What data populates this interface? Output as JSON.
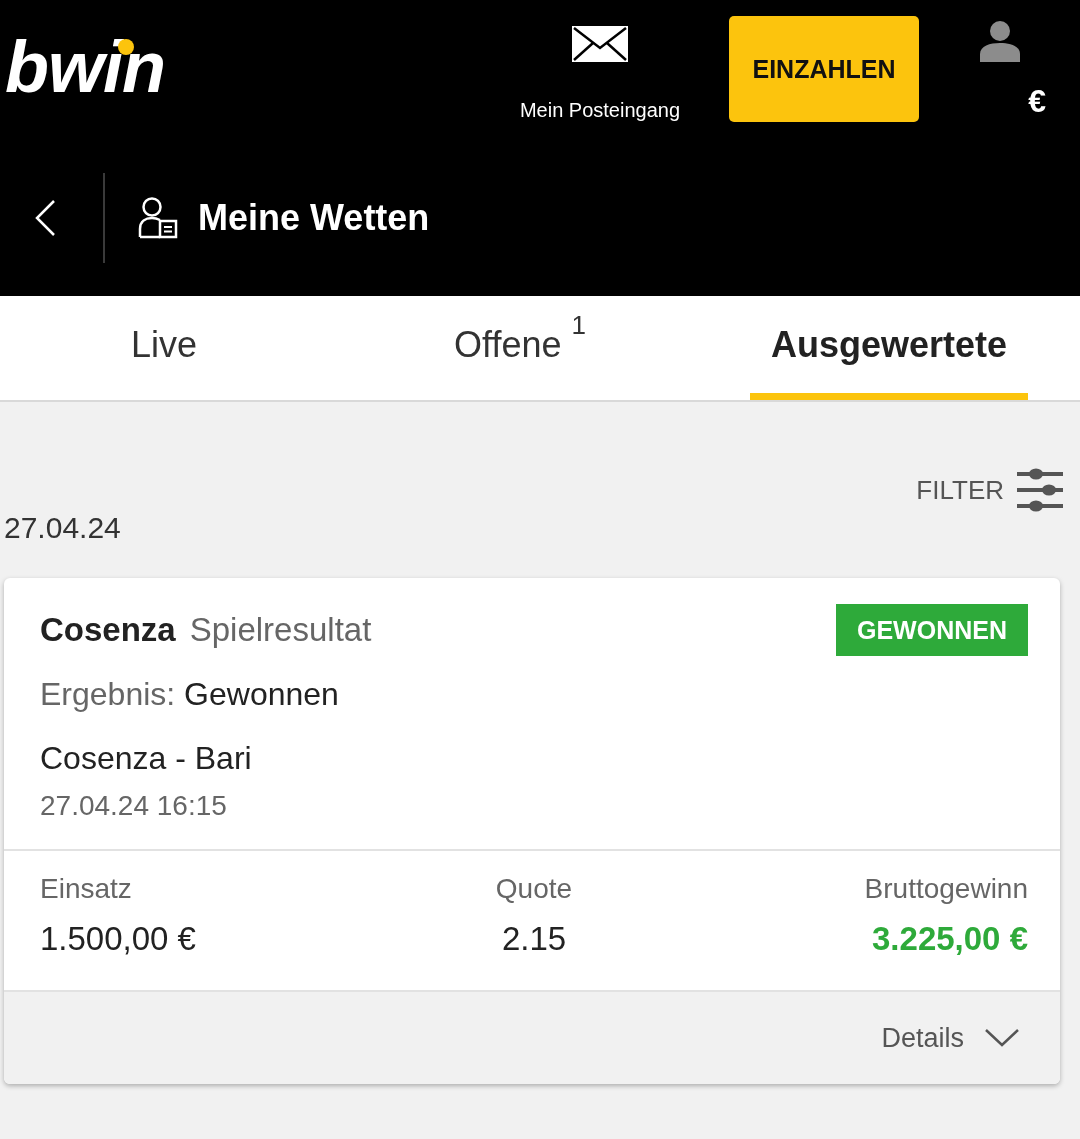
{
  "header": {
    "logo": "bwin",
    "inbox_label": "Mein Posteingang",
    "deposit_button": "EINZAHLEN",
    "balance": "€"
  },
  "page_bar": {
    "title": "Meine Wetten"
  },
  "tabs": [
    {
      "label": "Live",
      "selected": false
    },
    {
      "label": "Offene",
      "count": "1",
      "selected": false
    },
    {
      "label": "Ausgewertete",
      "selected": true
    }
  ],
  "filter": {
    "label": "FILTER"
  },
  "bets": [
    {
      "date": "27.04.24",
      "selection": "Cosenza",
      "market": "Spielresultat",
      "status": {
        "label": "GEWONNEN",
        "kind": "won"
      },
      "result_label": "Ergebnis:",
      "result": "Gewonnen",
      "event": "Cosenza - Bari",
      "start_time": "27.04.24 16:15",
      "stats": [
        {
          "label": "Einsatz",
          "value": "1.500,00 €",
          "kind": "plain"
        },
        {
          "label": "Quote",
          "value": "2.15",
          "kind": "plain"
        },
        {
          "label": "Bruttogewinn",
          "value": "3.225,00 €",
          "kind": "payout"
        }
      ],
      "details_label": "Details"
    }
  ]
}
